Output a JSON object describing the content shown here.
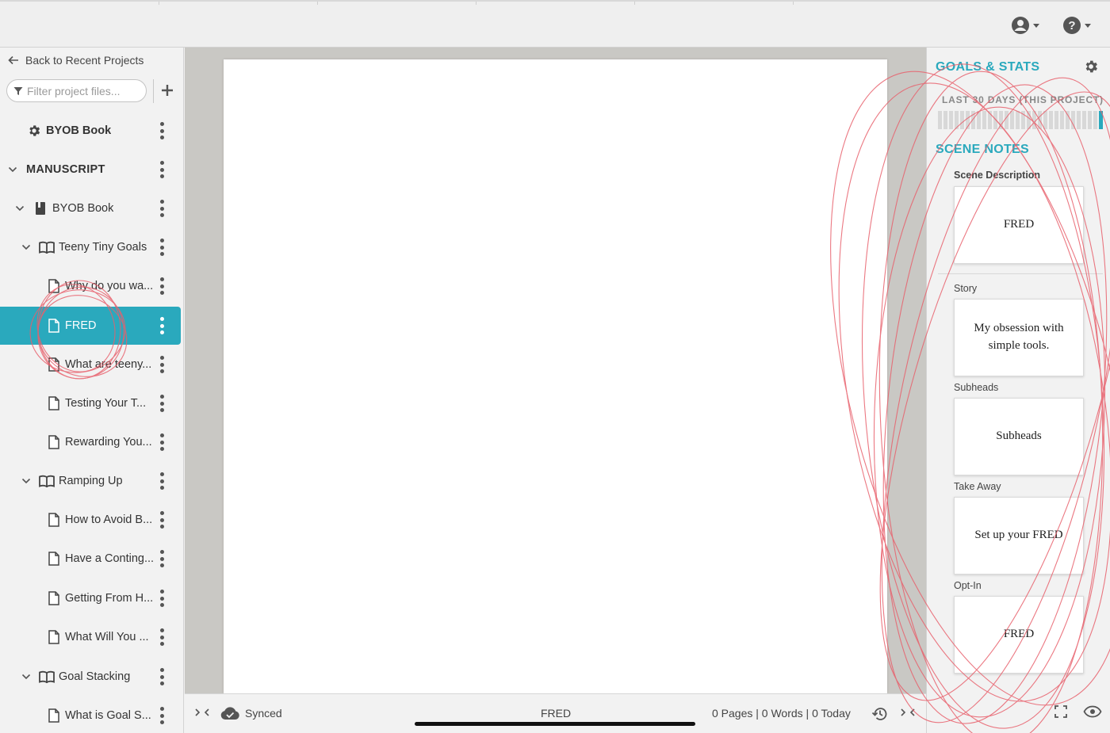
{
  "topbar": {
    "account_icon": "account-circle-icon",
    "help_icon": "help-circle-icon"
  },
  "sidebar": {
    "back_label": "Back to Recent Projects",
    "filter_placeholder": "Filter project files...",
    "tree": [
      {
        "label": "BYOB Book",
        "icon": "gear-icon",
        "bold": true
      },
      {
        "label": "MANUSCRIPT",
        "icon": "chevron-down-icon",
        "bold": true
      },
      {
        "label": "BYOB Book",
        "icon": "book-icon"
      },
      {
        "label": "Teeny Tiny Goals",
        "icon": "open-book-icon"
      },
      {
        "label": "Why do you wa...",
        "icon": "document-icon"
      },
      {
        "label": "FRED",
        "icon": "document-icon",
        "active": true
      },
      {
        "label": "What are teeny...",
        "icon": "document-icon"
      },
      {
        "label": "Testing Your T...",
        "icon": "document-icon"
      },
      {
        "label": "Rewarding You...",
        "icon": "document-icon"
      },
      {
        "label": "Ramping Up",
        "icon": "open-book-icon"
      },
      {
        "label": "How to Avoid B...",
        "icon": "document-icon"
      },
      {
        "label": "Have a Conting...",
        "icon": "document-icon"
      },
      {
        "label": "Getting From H...",
        "icon": "document-icon"
      },
      {
        "label": "What Will You ...",
        "icon": "document-icon"
      },
      {
        "label": "Goal Stacking",
        "icon": "open-book-icon"
      },
      {
        "label": "What is Goal S...",
        "icon": "document-icon"
      }
    ]
  },
  "statusbar": {
    "sync_label": "Synced",
    "doc_title": "FRED",
    "counts": "0 Pages | 0 Words | 0 Today"
  },
  "right_panel": {
    "goals_title": "GOALS & STATS",
    "goals_subtitle": "LAST 30 DAYS (THIS PROJECT)",
    "daily_activity": [
      0,
      0,
      0,
      0,
      0,
      0,
      0,
      0,
      0,
      0,
      0,
      0,
      0,
      0,
      0,
      0,
      0,
      0,
      0,
      0,
      0,
      0,
      0,
      0,
      0,
      0,
      0,
      0,
      0,
      1
    ],
    "accent_color": "#2aa9bd",
    "scene_notes_title": "SCENE NOTES",
    "notes": [
      {
        "label": "Scene Description",
        "value": "FRED"
      },
      {
        "label": "Story",
        "value": "My obsession with simple tools."
      },
      {
        "label": "Subheads",
        "value": "Subheads"
      },
      {
        "label": "Take Away",
        "value": "Set up your FRED"
      },
      {
        "label": "Opt-In",
        "value": "FRED"
      }
    ]
  },
  "annotation_color": "#e8606c"
}
